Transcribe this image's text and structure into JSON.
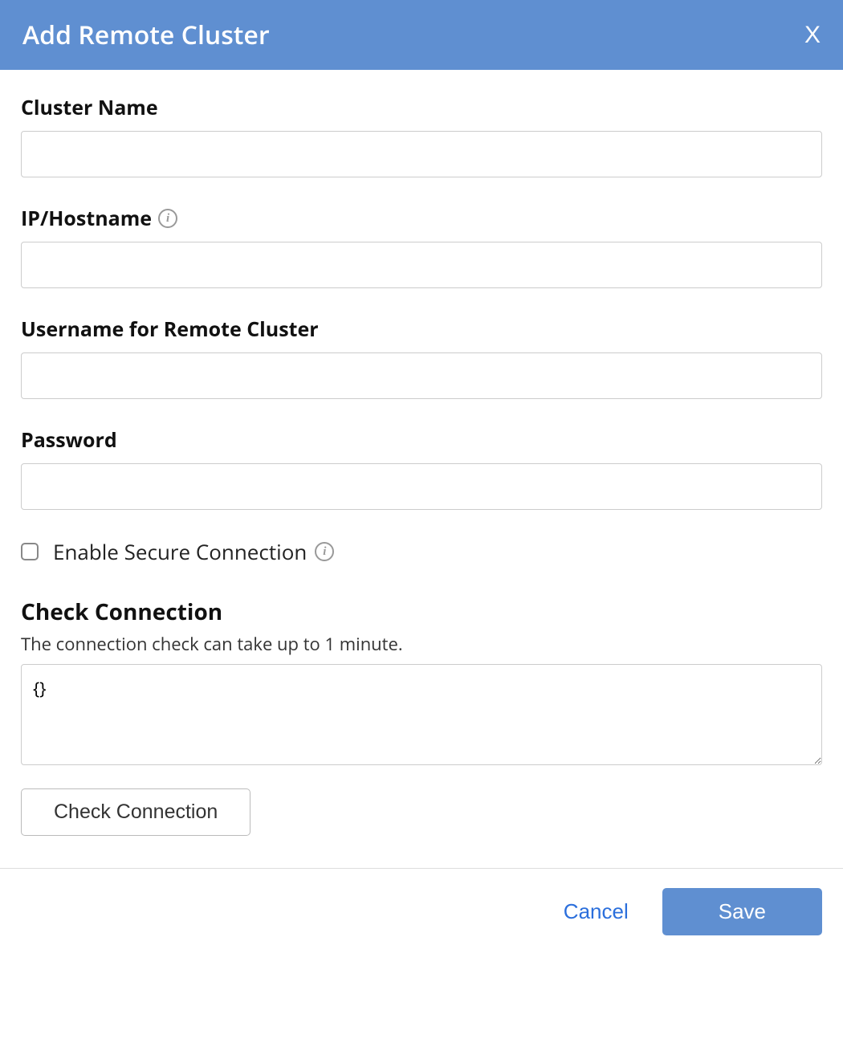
{
  "header": {
    "title": "Add Remote Cluster",
    "close": "X"
  },
  "fields": {
    "clusterName": {
      "label": "Cluster Name",
      "value": ""
    },
    "ipHostname": {
      "label": "IP/Hostname",
      "value": ""
    },
    "username": {
      "label": "Username for Remote Cluster",
      "value": ""
    },
    "password": {
      "label": "Password",
      "value": ""
    }
  },
  "secure": {
    "label": "Enable Secure Connection",
    "checked": false
  },
  "checkConnection": {
    "title": "Check Connection",
    "desc": "The connection check can take up to 1 minute.",
    "output": "{}",
    "button": "Check Connection"
  },
  "footer": {
    "cancel": "Cancel",
    "save": "Save"
  }
}
